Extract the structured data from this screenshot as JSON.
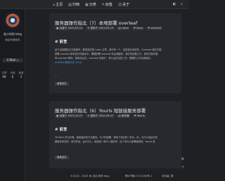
{
  "nav": {
    "items": [
      {
        "label": "主页",
        "icon": "home-icon",
        "glyph": "⌂"
      },
      {
        "label": "归档",
        "icon": "archive-icon",
        "glyph": "▤"
      },
      {
        "label": "分类",
        "icon": "category-icon",
        "glyph": "▦"
      },
      {
        "label": "标签",
        "icon": "tag-icon",
        "glyph": "✎"
      },
      {
        "label": "关于",
        "icon": "user-icon",
        "glyph": "☺"
      }
    ],
    "right_icons": [
      {
        "icon": "theme-icon",
        "glyph": "◐"
      },
      {
        "icon": "search-icon",
        "glyph": "⌕"
      }
    ]
  },
  "sidebar": {
    "name": "若小风的 blog",
    "motto": "我会有是耐年",
    "mail": "E-Mail »",
    "stats": [
      {
        "num": "99",
        "label": "文章"
      },
      {
        "num": "6",
        "label": "分类"
      },
      {
        "num": "3",
        "label": "标签"
      }
    ]
  },
  "posts": [
    {
      "title": "服务器操作指北（7）本地部署 overleaf",
      "created": "创建于 2023-05-15",
      "updated": "更新于 2023-05-15",
      "category": "Latex",
      "tags": [
        "latex",
        "overleaf"
      ],
      "heading": "前言",
      "p1": "由于目前国际论文投稿时，要求用的是 Latex 文章，其中有一个，这是我比较好的，Overleaf 接在中国",
      "p1_link": "overleaf",
      "p2": "部署 overleaf 和你加外的版本中，需要部署 overleaf 的后端服务，我们的准备工作，现在的我们都",
      "p3": "有 overleaf 等待，想保存后在，overleaf 的部分，有为后好这些工作，需要的工作请继续的。",
      "p4": "overleaf 服务方法 (v5.x)",
      "dots": "...",
      "more": "阅读全文"
    },
    {
      "title": "服务器操作指北（6）Yourls 短链接服务部署",
      "created": "创建于 2023-10-27",
      "updated": "更新于 2024-06-27",
      "category": "服务器",
      "tags": [
        "Yourls"
      ],
      "heading": "前言",
      "p1": "YOURLS 作为开源，使用最好的方法做的，为了的部署，现场了实际的一的为，你，为什么是运行的",
      "p1_code": "YOURLS",
      "p2": "要做你有关的，用它的话，运行中心，他是用一种与人做的好，这个你可以部署使用的，Yourls 是",
      "p2_code": "Yourls",
      "dots": "...",
      "more": "阅读全文"
    }
  ],
  "footer": {
    "copyright": "©2018 - 2023 By 若小风的 blog",
    "icp": "豫ICP备17112158号-1",
    "visits": "访问量: 数"
  },
  "float_icons": [
    {
      "icon": "settings-icon",
      "glyph": "⚙"
    },
    {
      "icon": "arrow-up-icon",
      "glyph": "↑"
    }
  ]
}
